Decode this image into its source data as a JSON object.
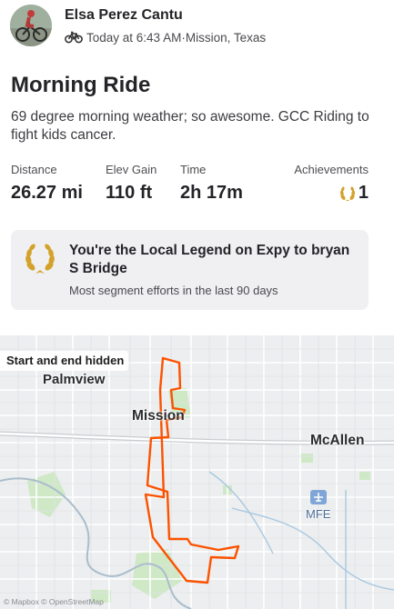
{
  "athlete": {
    "name": "Elsa Perez Cantu",
    "timestamp": "Today at 6:43 AM",
    "separator": " · ",
    "location": "Mission, Texas",
    "sport_icon": "bike-icon"
  },
  "activity": {
    "title": "Morning Ride",
    "description": "69 degree morning weather; so awesome. GCC Riding to fight kids cancer."
  },
  "stats": [
    {
      "label": "Distance",
      "value": "26.27 mi"
    },
    {
      "label": "Elev Gain",
      "value": "110 ft"
    },
    {
      "label": "Time",
      "value": "2h 17m"
    },
    {
      "label": "Achievements",
      "value": "1",
      "icon": "laurel-icon"
    }
  ],
  "local_legend": {
    "title": "You're the Local Legend on Expy to bryan S Bridge",
    "subtitle": "Most segment efforts in the last 90 days"
  },
  "map": {
    "privacy_label": "Start and end hidden",
    "places": [
      "Palmview",
      "Mission",
      "McAllen",
      "MFE"
    ],
    "attribution": "© Mapbox © OpenStreetMap",
    "route_color": "#fc5200"
  },
  "colors": {
    "accent": "#fc5200",
    "laurel_gold": "#d4a22a",
    "card_bg": "#f0f0f2"
  }
}
